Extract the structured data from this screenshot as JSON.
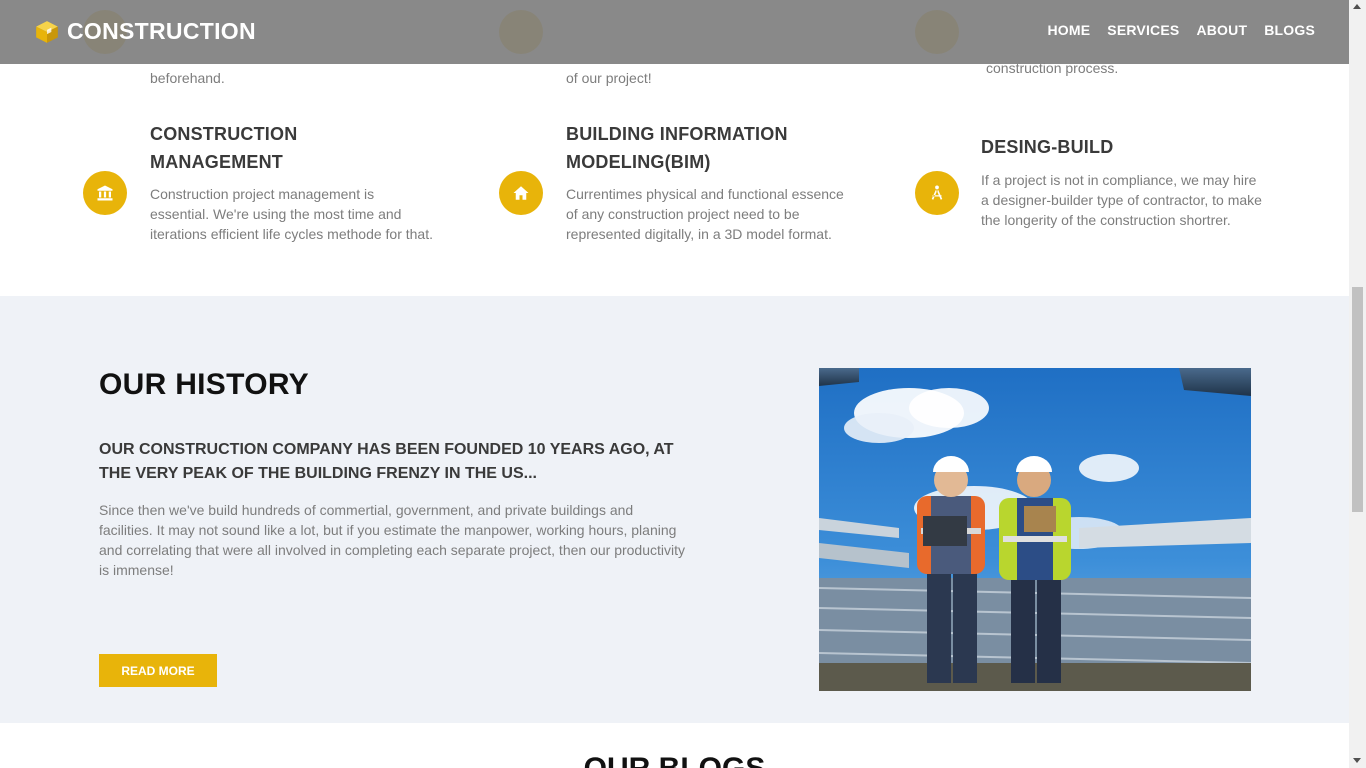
{
  "header": {
    "brand": "CONSTRUCTION",
    "nav": [
      {
        "label": "HOME"
      },
      {
        "label": "SERVICES"
      },
      {
        "label": "ABOUT"
      },
      {
        "label": "BLOGS"
      }
    ]
  },
  "services_top": [
    {
      "text": "beforehand."
    },
    {
      "text": "of our project!"
    },
    {
      "text": "construction process."
    }
  ],
  "services": [
    {
      "icon": "bank-icon",
      "title_line1": "CONSTRUCTION",
      "title_line2": "MANAGEMENT",
      "description": "Construction project management is essential. We're using the most time and iterations efficient life cycles methode for that."
    },
    {
      "icon": "home-icon",
      "title_line1": "BUILDING INFORMATION",
      "title_line2": "MODELING(BIM)",
      "description": "Currentimes physical and functional essence of any construction project need to be represented digitally, in a 3D model format."
    },
    {
      "icon": "compass-drafting-icon",
      "title_line1": "DESING-BUILD",
      "description": "If a project is not in compliance, we may hire a designer-builder type of contractor, to make the longerity of the construction shortrer."
    }
  ],
  "history": {
    "title": "OUR HISTORY",
    "subtitle": "OUR CONSTRUCTION COMPANY HAS BEEN FOUNDED 10 YEARS AGO, AT THE VERY PEAK OF THE BUILDING FRENZY IN THE US...",
    "body": "Since then we've build hundreds of commertial, government, and private buildings and facilities. It may not sound like a lot, but if you estimate the manpower, working hours, planing and correlating that were all involved in completing each separate project, then our productivity is immense!",
    "button": "READ MORE"
  },
  "blogs": {
    "title": "OUR BLOGS"
  },
  "colors": {
    "accent": "#e8b40a",
    "section_bg": "#eff2f7",
    "header_bg": "#808080"
  }
}
